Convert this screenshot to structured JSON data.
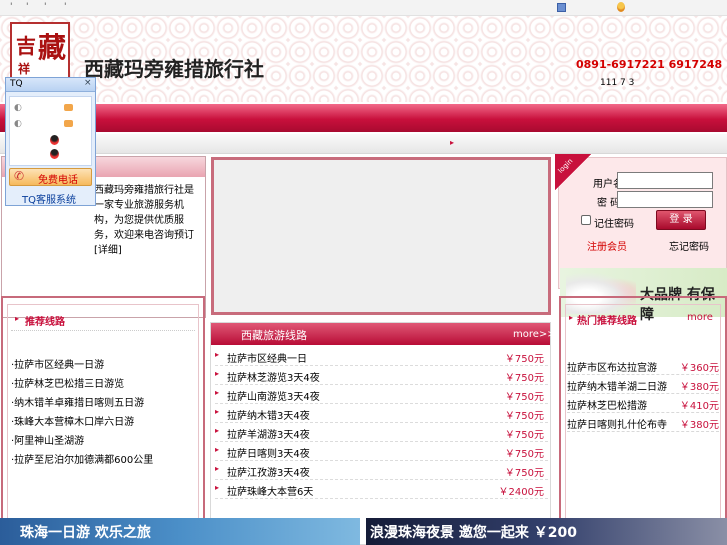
{
  "topbar": {
    "links": [
      "'",
      "'",
      "'",
      "'"
    ]
  },
  "header": {
    "site_name": "西藏玛旁雍措旅行社",
    "phone": "0891-6917221 6917248",
    "counter": "111 7 3"
  },
  "about": {
    "text": "西藏玛旁雍措旅行社是一家专业旅游服务机构，为您提供优质服务，欢迎来电咨询预订[详细]"
  },
  "login": {
    "tag": "login",
    "username_label": "用户名：",
    "password_label": "密 码：",
    "remember_label": "记住密码",
    "login_button": "登 录",
    "register_link": "注册会员",
    "forgot_link": "忘记密码"
  },
  "brand_banner": {
    "text": "大品牌  有保障"
  },
  "links_box": {
    "title": "推荐线路",
    "items": [
      "·拉萨市区经典一日游",
      "·拉萨林芝巴松措三日游览",
      "·纳木错羊卓雍措日喀则五日游",
      "·珠峰大本营樟木口岸六日游",
      "·阿里神山圣湖游",
      "·拉萨至尼泊尔加德满都600公里"
    ]
  },
  "routes": {
    "title": "西藏旅游线路",
    "more": "more>>",
    "rows": [
      {
        "name": "拉萨市区经典一日",
        "price": "￥750元"
      },
      {
        "name": "拉萨林芝游览3天4夜",
        "price": "￥750元"
      },
      {
        "name": "拉萨山南游览3天4夜",
        "price": "￥750元"
      },
      {
        "name": "拉萨纳木错3天4夜",
        "price": "￥750元"
      },
      {
        "name": "拉萨羊湖游3天4夜",
        "price": "￥750元"
      },
      {
        "name": "拉萨日喀则3天4夜",
        "price": "￥750元"
      },
      {
        "name": "拉萨江孜游3天4夜",
        "price": "￥750元"
      },
      {
        "name": "拉萨珠峰大本营6天",
        "price": "￥2400元"
      }
    ]
  },
  "hot": {
    "title": "热门推荐线路",
    "more": "more",
    "rows": [
      {
        "name": "拉萨市区布达拉宫游",
        "price": "￥360元"
      },
      {
        "name": "拉萨纳木错羊湖二日游",
        "price": "￥380元"
      },
      {
        "name": "拉萨林芝巴松措游",
        "price": "￥410元"
      },
      {
        "name": "拉萨日喀则扎什伦布寺",
        "price": "￥380元"
      }
    ]
  },
  "ads": {
    "left_text": "珠海一日游 欢乐之旅",
    "right_text": "浪漫珠海夜景 邀您一起来 ￥200"
  },
  "tq": {
    "title": "TQ",
    "close": "×",
    "call_label": "免费电话",
    "footer": "TQ客服系统"
  },
  "colors": {
    "accent": "#c8103c",
    "border": "#c76a7b",
    "phone": "#d40000"
  }
}
